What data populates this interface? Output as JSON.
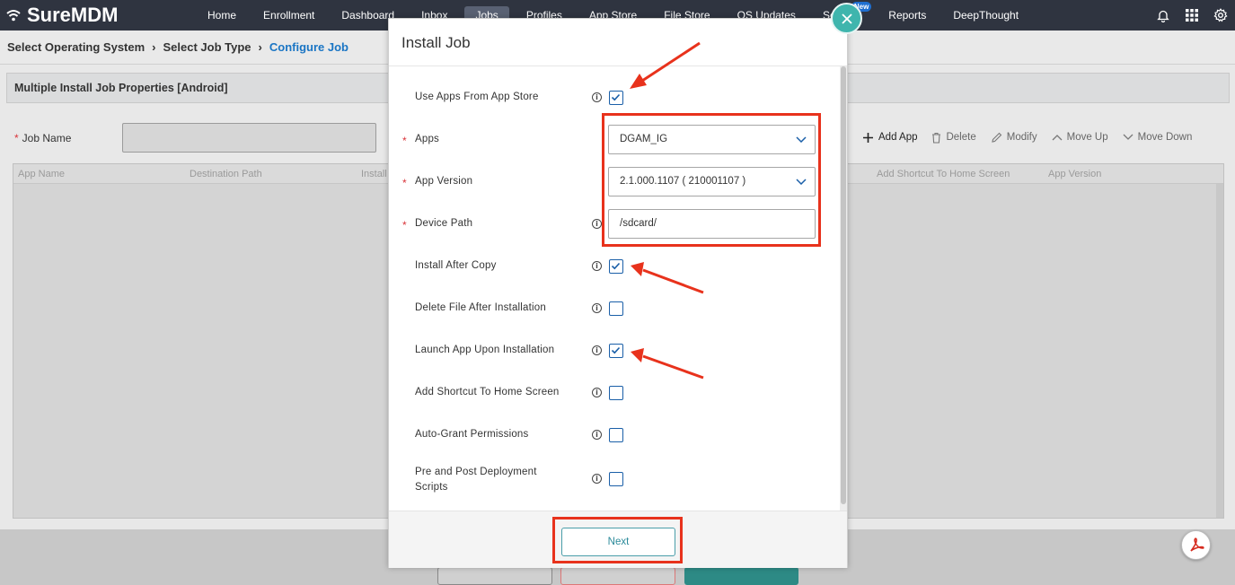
{
  "app": {
    "brand": "SureMDM"
  },
  "nav": {
    "items": [
      {
        "label": "Home"
      },
      {
        "label": "Enrollment"
      },
      {
        "label": "Dashboard"
      },
      {
        "label": "Inbox"
      },
      {
        "label": "Jobs"
      },
      {
        "label": "Profiles"
      },
      {
        "label": "App Store"
      },
      {
        "label": "File Store"
      },
      {
        "label": "OS Updates"
      },
      {
        "label": "Security"
      },
      {
        "label": "Reports"
      },
      {
        "label": "DeepThought"
      }
    ],
    "active": "Jobs",
    "new_badge": "New",
    "icons": [
      "bell-icon",
      "apps-grid-icon",
      "gear-icon"
    ]
  },
  "breadcrumb": {
    "step1": "Select Operating System",
    "step2": "Select Job Type",
    "step3": "Configure Job"
  },
  "page": {
    "section_title": "Multiple Install Job Properties [Android]",
    "job_name_label": "Job Name",
    "job_name_value": "",
    "toolbar": {
      "add": "Add App",
      "delete": "Delete",
      "modify": "Modify",
      "move_up": "Move Up",
      "move_down": "Move Down"
    },
    "grid_columns": {
      "c1": "App Name",
      "c2": "Destination Path",
      "c3": "Install",
      "c4": "Add Shortcut To Home Screen",
      "c5": "App Version"
    }
  },
  "modal": {
    "title": "Install Job",
    "fields": {
      "use_app_store": {
        "label": "Use Apps From App Store",
        "checked": true
      },
      "apps": {
        "label": "Apps",
        "value": "DGAM_IG"
      },
      "app_version": {
        "label": "App Version",
        "value": "2.1.000.1107 ( 210001107 )"
      },
      "device_path": {
        "label": "Device Path",
        "value": "/sdcard/"
      },
      "install_after_copy": {
        "label": "Install After Copy",
        "checked": true
      },
      "delete_after_install": {
        "label": "Delete File After Installation",
        "checked": false
      },
      "launch_app": {
        "label": "Launch App Upon Installation",
        "checked": true
      },
      "add_shortcut": {
        "label": "Add Shortcut To Home Screen",
        "checked": false
      },
      "auto_grant": {
        "label": "Auto-Grant Permissions",
        "checked": false
      },
      "pre_post_line1": "Pre and Post Deployment",
      "pre_post_line2": "Scripts",
      "pre_post_checked": false
    },
    "next_label": "Next",
    "info_glyph": "i"
  },
  "colors": {
    "nav_bg": "#2f3440",
    "accent": "#1a75c4",
    "highlight": "#e8321c",
    "close_bg": "#3fb5ad"
  }
}
